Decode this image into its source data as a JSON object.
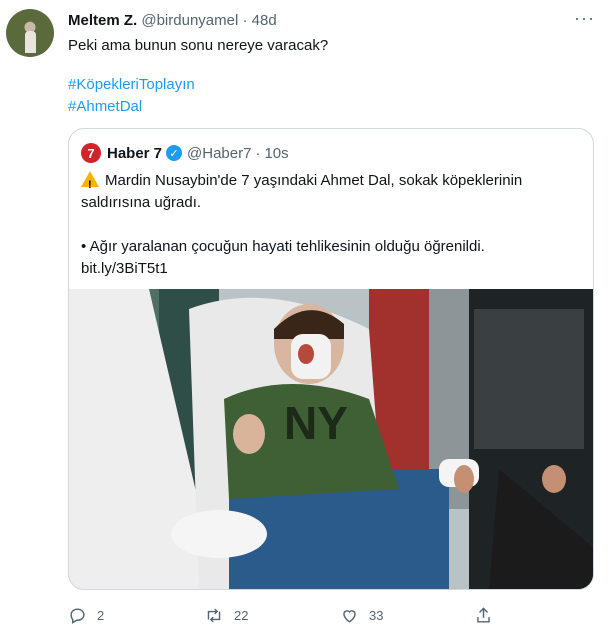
{
  "tweet": {
    "name": "Meltem Z.",
    "handle": "@birdunyamel",
    "time": "48d",
    "more": "···",
    "text": "Peki ama bunun sonu nereye varacak?",
    "hashtags": [
      "#KöpekleriToplayın",
      "#AhmetDal"
    ]
  },
  "quoted": {
    "logo": "7",
    "name": "Haber 7",
    "handle": "@Haber7",
    "time": "10s",
    "line1": "Mardin Nusaybin'de 7 yaşındaki Ahmet Dal, sokak köpeklerinin saldırısına uğradı.",
    "line2": "• Ağır yaralanan çocuğun hayati tehlikesinin olduğu öğrenildi.",
    "link": "bit.ly/3BiT5t1",
    "photo_text": "NY"
  },
  "actions": {
    "reply_count": "2",
    "retweet_count": "22",
    "like_count": "33"
  },
  "colors": {
    "link": "#1d9bf0",
    "muted": "#536471",
    "haber_red": "#d2232a",
    "warning": "#f4b400"
  },
  "icons": [
    "more-icon",
    "verified-icon",
    "warning-icon",
    "reply-icon",
    "retweet-icon",
    "like-icon",
    "share-icon"
  ]
}
